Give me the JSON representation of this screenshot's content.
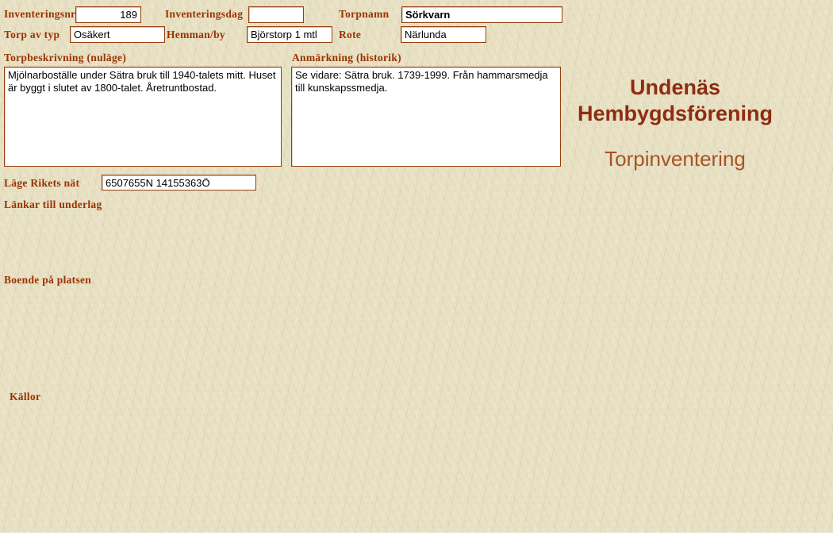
{
  "header": {
    "org_line1": "Undenäs",
    "org_line2": "Hembygdsförening",
    "subtitle": "Torpinventering"
  },
  "form": {
    "inventeringsnr": {
      "label": "Inventeringsnr",
      "value": "189"
    },
    "inventeringsdag": {
      "label": "Inventeringsdag",
      "value": ""
    },
    "torpnamn": {
      "label": "Torpnamn",
      "value": "Sörkvarn"
    },
    "torp_av_typ": {
      "label": "Torp av typ",
      "value": "Osäkert"
    },
    "hemman_by": {
      "label": "Hemman/by",
      "value": "Björstorp 1 mtl"
    },
    "rote": {
      "label": "Rote",
      "value": "Närlunda"
    },
    "torpbeskrivning": {
      "label": "Torpbeskrivning (nuläge)",
      "value": "Mjölnarboställe under Sätra bruk till 1940-talets mitt. Huset är byggt i slutet av 1800-talet. Åretruntbostad."
    },
    "anmarkning": {
      "label": "Anmärkning (historik)",
      "value": "Se vidare: Sätra bruk. 1739-1999. Från hammarsmedja till kunskapssmedja."
    },
    "lage_rikets_nat": {
      "label": "Läge Rikets nät",
      "value": "6507655N 14155363Ö"
    },
    "lankar_label": "Länkar till underlag",
    "boende_label": "Boende på platsen",
    "kallor_label": "Källor"
  },
  "colors": {
    "background": "#e9e2c5",
    "label_text": "#993300",
    "org_heading": "#8e2c12",
    "subtitle": "#a85327",
    "field_border": "#96400f"
  }
}
